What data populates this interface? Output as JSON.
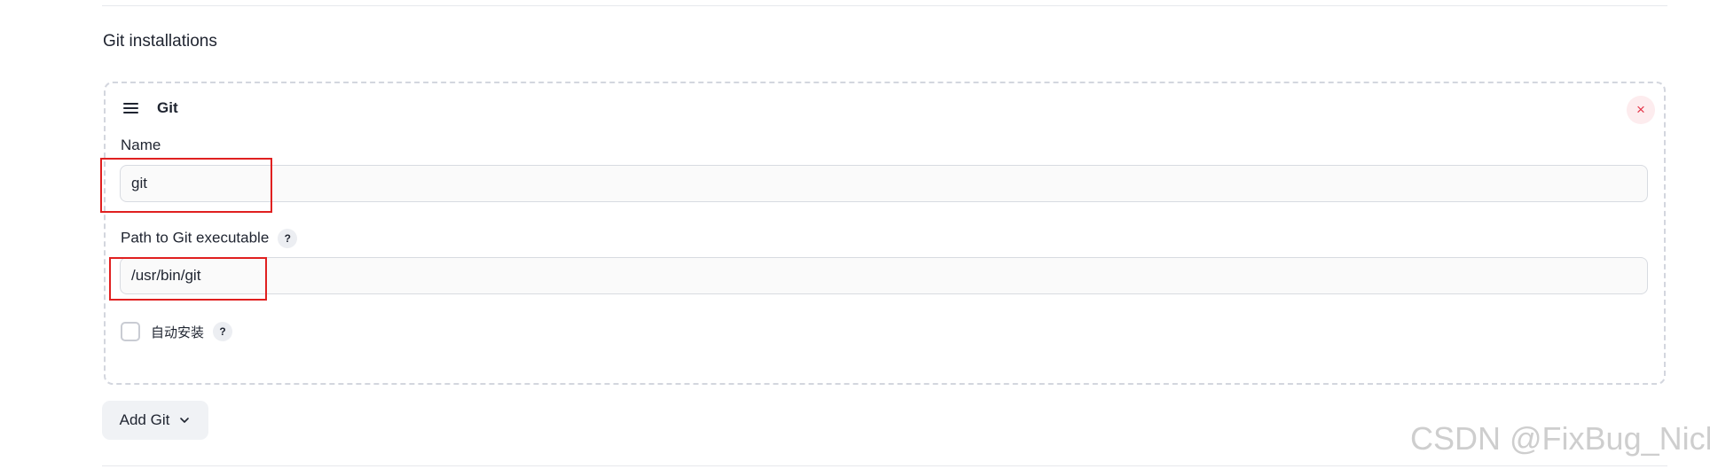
{
  "section": {
    "title": "Git installations"
  },
  "git_block": {
    "title": "Git",
    "delete_symbol": "×",
    "name_field": {
      "label": "Name",
      "value": "git"
    },
    "path_field": {
      "label": "Path to Git executable",
      "value": "/usr/bin/git"
    },
    "auto_install": {
      "label": "自动安装",
      "checked": false
    },
    "help_symbol": "?"
  },
  "add_button": {
    "label": "Add Git"
  },
  "annotation_color": "#e02020",
  "watermark": "CSDN @FixBug_Nick"
}
